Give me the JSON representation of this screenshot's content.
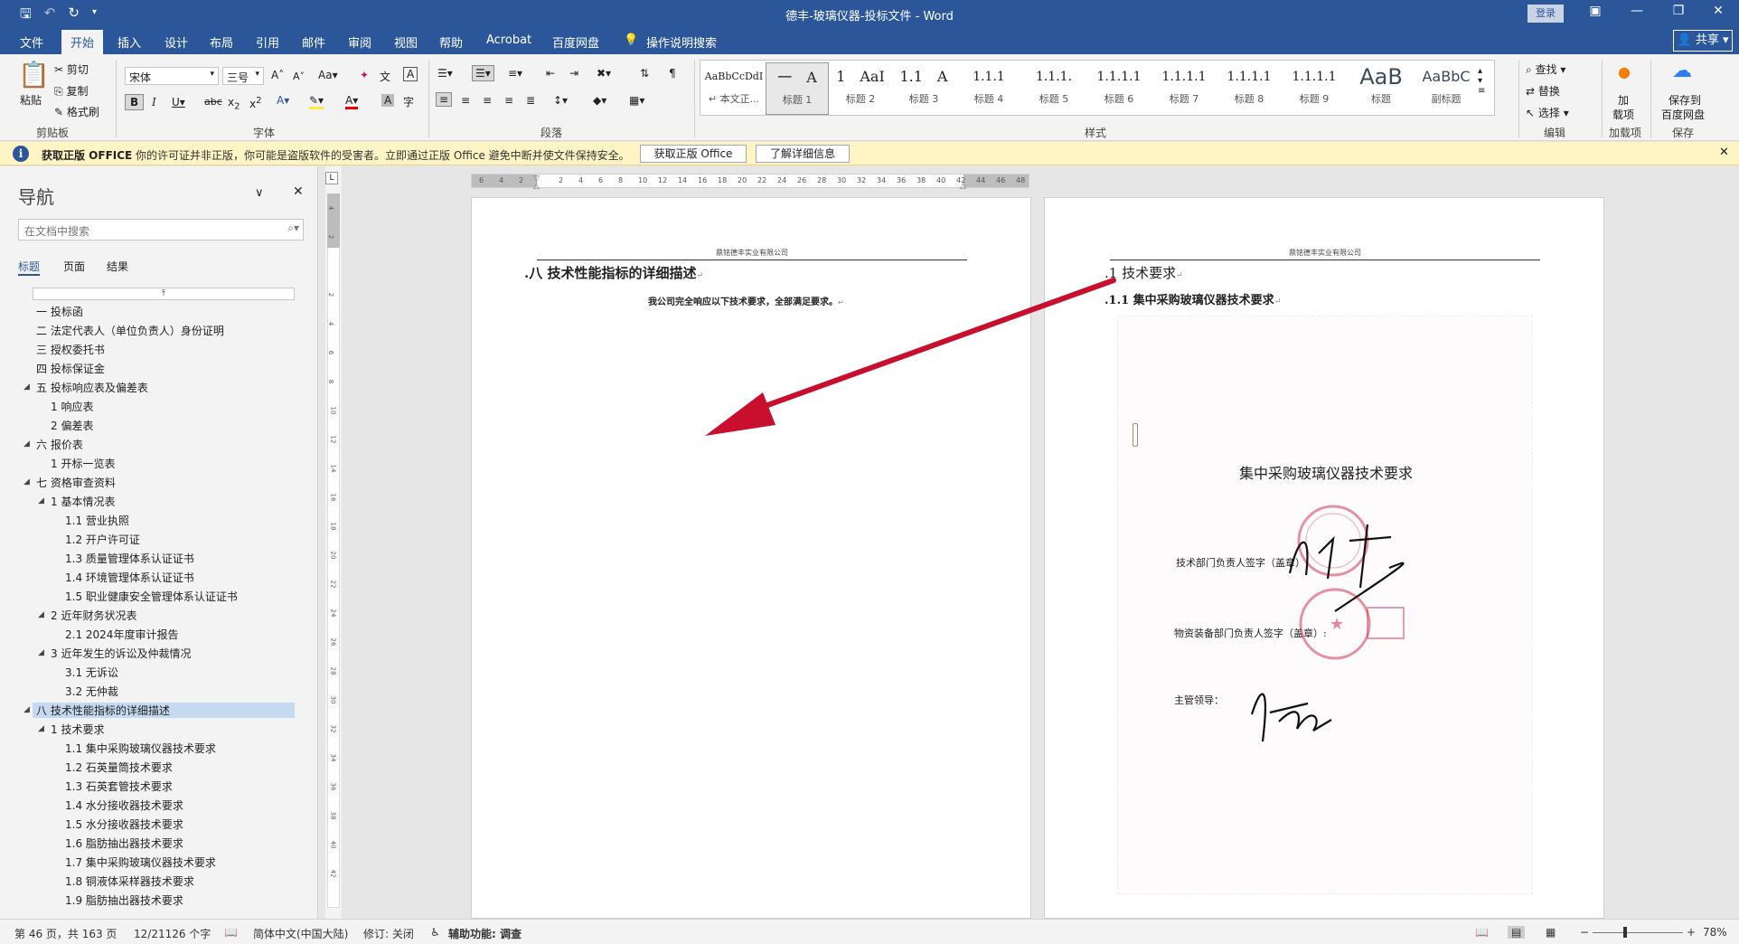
{
  "window": {
    "title": "德丰-玻璃仪器-投标文件 - Word",
    "login_label": "登录",
    "share_label": "共享",
    "qat": {
      "save_icon": "save-icon",
      "undo_icon": "undo-icon",
      "redo_icon": "repeat-icon",
      "more_icon": "customize-icon"
    }
  },
  "tabs": [
    {
      "label": "文件"
    },
    {
      "label": "开始"
    },
    {
      "label": "插入"
    },
    {
      "label": "设计"
    },
    {
      "label": "布局"
    },
    {
      "label": "引用"
    },
    {
      "label": "邮件"
    },
    {
      "label": "审阅"
    },
    {
      "label": "视图"
    },
    {
      "label": "帮助"
    },
    {
      "label": "Acrobat"
    },
    {
      "label": "百度网盘"
    },
    {
      "label": "操作说明搜索"
    }
  ],
  "ribbon": {
    "clipboard": {
      "paste": "粘贴",
      "cut": "剪切",
      "copy": "复制",
      "format_painter": "格式刷",
      "group": "剪贴板"
    },
    "font": {
      "name": "宋体",
      "size": "三号",
      "group": "字体"
    },
    "paragraph": {
      "group": "段落"
    },
    "styles": {
      "group": "样式",
      "items": [
        {
          "preview": "AaBbCcDdI",
          "name": "↵ 本文正..."
        },
        {
          "preview": "一　A",
          "name": "标题 1"
        },
        {
          "preview": "1　AaI",
          "name": "标题 2"
        },
        {
          "preview": "1.1　A",
          "name": "标题 3"
        },
        {
          "preview": "1.1.1",
          "name": "标题 4"
        },
        {
          "preview": "1.1.1.",
          "name": "标题 5"
        },
        {
          "preview": "1.1.1.1",
          "name": "标题 6"
        },
        {
          "preview": "1.1.1.1",
          "name": "标题 7"
        },
        {
          "preview": "1.1.1.1",
          "name": "标题 8"
        },
        {
          "preview": "1.1.1.1",
          "name": "标题 9"
        },
        {
          "preview": "AaB",
          "name": "标题"
        },
        {
          "preview": "AaBbC",
          "name": "副标题"
        }
      ]
    },
    "editing": {
      "find": "查找",
      "replace": "替换",
      "select": "选择",
      "group": "编辑"
    },
    "addins": {
      "label1": "加",
      "label2": "载项",
      "group": "加载项"
    },
    "save": {
      "label1": "保存到",
      "label2": "百度网盘",
      "group": "保存"
    }
  },
  "infobar": {
    "title": "获取正版 OFFICE",
    "message": "你的许可证并非正版，你可能是盗版软件的受害者。立即通过正版 Office 避免中断并使文件保持安全。",
    "btn1": "获取正版 Office",
    "btn2": "了解详细信息"
  },
  "nav": {
    "title": "导航",
    "search_placeholder": "在文档中搜索",
    "tabs": [
      "标题",
      "页面",
      "结果"
    ],
    "items": [
      {
        "label": "一 投标函"
      },
      {
        "label": "二 法定代表人（单位负责人）身份证明"
      },
      {
        "label": "三 授权委托书"
      },
      {
        "label": "四 投标保证金"
      },
      {
        "label": "五 投标响应表及偏差表"
      },
      {
        "label": "1 响应表"
      },
      {
        "label": "2 偏差表"
      },
      {
        "label": "六 报价表"
      },
      {
        "label": "1 开标一览表"
      },
      {
        "label": "七 资格审查资料"
      },
      {
        "label": "1 基本情况表"
      },
      {
        "label": "1.1 营业执照"
      },
      {
        "label": "1.2 开户许可证"
      },
      {
        "label": "1.3 质量管理体系认证证书"
      },
      {
        "label": "1.4 环境管理体系认证证书"
      },
      {
        "label": "1.5 职业健康安全管理体系认证证书"
      },
      {
        "label": "2 近年财务状况表"
      },
      {
        "label": "2.1 2024年度审计报告"
      },
      {
        "label": "3 近年发生的诉讼及仲裁情况"
      },
      {
        "label": "3.1 无诉讼"
      },
      {
        "label": "3.2 无仲裁"
      },
      {
        "label": "八 技术性能指标的详细描述"
      },
      {
        "label": "1 技术要求"
      },
      {
        "label": "1.1 集中采购玻璃仪器技术要求"
      },
      {
        "label": "1.2 石英量筒技术要求"
      },
      {
        "label": "1.3 石英套管技术要求"
      },
      {
        "label": "1.4 水分接收器技术要求"
      },
      {
        "label": "1.5 水分接收器技术要求"
      },
      {
        "label": "1.6 脂肪抽出器技术要求"
      },
      {
        "label": "1.7 集中采购玻璃仪器技术要求"
      },
      {
        "label": "1.8 铜液体采样器技术要求"
      },
      {
        "label": "1.9 脂肪抽出器技术要求"
      }
    ]
  },
  "ruler": {
    "h_ticks": [
      "6",
      "4",
      "2",
      "",
      "2",
      "4",
      "6",
      "8",
      "10",
      "12",
      "14",
      "16",
      "18",
      "20",
      "22",
      "24",
      "26",
      "28",
      "30",
      "32",
      "34",
      "36",
      "38",
      "40",
      "42",
      "44",
      "46",
      "48"
    ],
    "v_ticks": [
      "4",
      "2",
      "",
      "2",
      "4",
      "6",
      "8",
      "10",
      "12",
      "14",
      "16",
      "18",
      "20",
      "22",
      "24",
      "26",
      "28",
      "30",
      "32",
      "34",
      "36",
      "38",
      "40",
      "42"
    ]
  },
  "page1": {
    "header": "鼎铭德丰实业有限公司",
    "heading": "八 技术性能指标的详细描述",
    "body": "我公司完全响应以下技术要求，全部满足要求。"
  },
  "page2": {
    "header": "鼎铭德丰实业有限公司",
    "heading1": "1 技术要求",
    "heading2": "1.1 集中采购玻璃仪器技术要求",
    "scan_title": "集中采购玻璃仪器技术要求",
    "sig1": "技术部门负责人签字（盖章）:",
    "sig2": "物资装备部门负责人签字（盖章）:",
    "sig3": "主管领导："
  },
  "status": {
    "page": "第 46 页，共 163 页",
    "words": "12/21126 个字",
    "lang": "简体中文(中国大陆)",
    "track": "修订: 关闭",
    "access": "辅助功能: 调查",
    "zoom": "78%"
  },
  "colors": {
    "accent": "#2b579a",
    "arrow": "#c8102e",
    "stamp": "#d23b5a"
  }
}
